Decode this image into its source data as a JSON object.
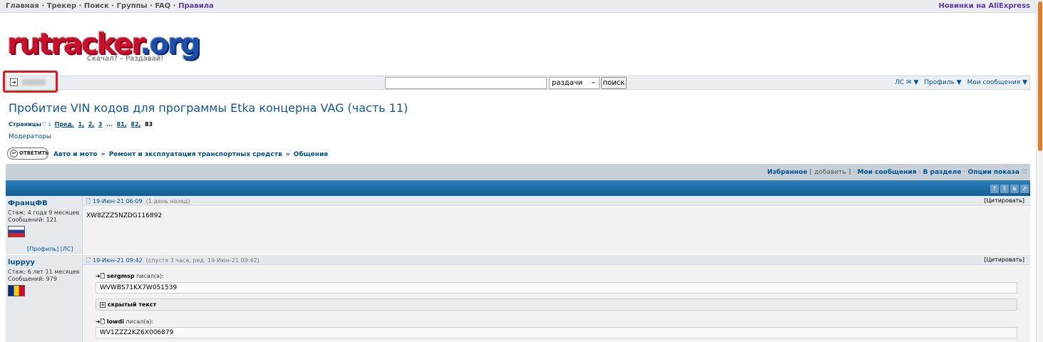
{
  "topnav": {
    "links": [
      "Главная",
      "Трекер",
      "Поиск",
      "Группы",
      "FAQ",
      "Правила"
    ],
    "separator": "·",
    "right_link": "Новинки на AliExpress"
  },
  "logo": {
    "word_main": "rutracker",
    "word_tld": ".org",
    "slogan": "Скачал? – Раздавай!"
  },
  "userbar": {
    "login_icon": "login-icon",
    "search_select_value": "раздачи",
    "search_button": "поиск",
    "menus": [
      "ЛС ✉ ▼",
      "Профиль ▼",
      "Мои сообщения ▼"
    ]
  },
  "topic": {
    "title": "Пробитие VIN кодов для программы Etka концерна VAG (часть 11)",
    "pages_label": "Страницы",
    "pages_prev": "Пред.",
    "pages": [
      "1,",
      "2,",
      "3",
      "...",
      "81,",
      "82,"
    ],
    "current_page": "83",
    "moderators": "Модераторы"
  },
  "actions": {
    "reply_label": "ОТВЕТИТЬ",
    "breadcrumbs": [
      "Авто и мото",
      "Ремонт и эксплуатация транспортных средств",
      "Общение"
    ],
    "breadcrumb_sep": "»"
  },
  "toolbar": {
    "favorites": "Избранное",
    "add": "добавить",
    "my_posts": "Мои сообщения",
    "in_section": "В разделе",
    "display_options": "Опции показа"
  },
  "posts": [
    {
      "nick": "ФранцФВ",
      "experience": "Стаж: 4 года 9 месяцев",
      "messages": "Сообщений: 121",
      "flag": "russia",
      "profile_links": "[Профиль]  [ЛС]",
      "date": "19-Июн-21 06:09",
      "date_note": "(1 день назад)",
      "quote_link": "[Цитировать]",
      "text": "XW8ZZZ5NZDG116892"
    },
    {
      "nick": "luppyy",
      "experience": "Стаж: 6 лет 11 месяцев",
      "messages": "Сообщений: 979",
      "flag": "romania",
      "date": "19-Июн-21 09:42",
      "date_note": "(спустя 3 часа, ред. 19-Июн-21 09:42)",
      "quote_link": "[Цитировать]",
      "quote1_author": "sergmsp",
      "quote1_suffix": "писал(а):",
      "quote1_text": "WVWBS71KX7W051539",
      "hidden_label": "скрытый текст",
      "quote2_author": "lowdi",
      "quote2_suffix": "писал(а):",
      "quote2_text": "WV1ZZZ2KZ6X006879"
    }
  ]
}
